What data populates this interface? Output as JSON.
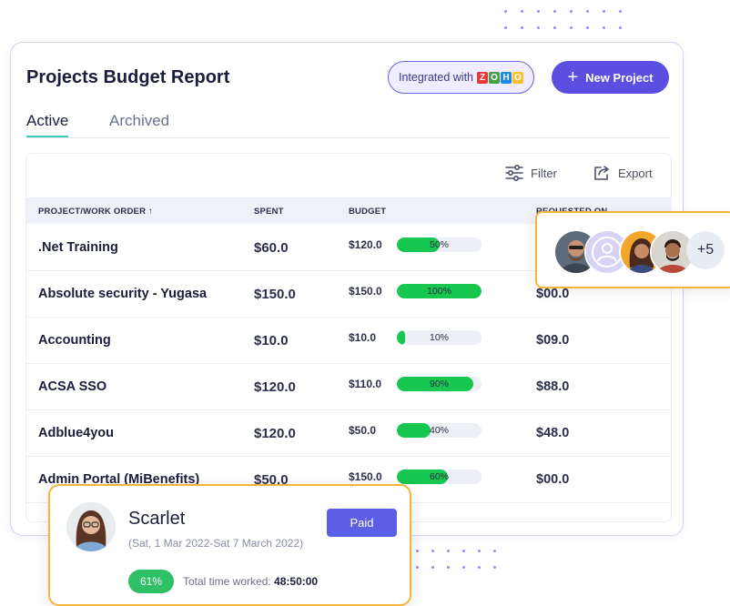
{
  "header": {
    "title": "Projects Budget Report",
    "integration_label": "Integrated with",
    "integration_logo_letters": [
      "Z",
      "O",
      "H",
      "O"
    ],
    "new_project_label": "New Project"
  },
  "tabs": [
    {
      "label": "Active",
      "active": true
    },
    {
      "label": "Archived",
      "active": false
    }
  ],
  "toolbar": {
    "filter_label": "Filter",
    "export_label": "Export"
  },
  "table": {
    "columns": {
      "project": "PROJECT/WORK ORDER ↑",
      "spent": "SPENT",
      "budget": "BUDGET",
      "requested": "REQUESTED ON"
    },
    "rows": [
      {
        "name": ".Net Training",
        "spent": "$60.0",
        "budget": "$120.0",
        "percent": 50,
        "percent_label": "50%",
        "requested": ""
      },
      {
        "name": "Absolute security - Yugasa",
        "spent": "$150.0",
        "budget": "$150.0",
        "percent": 100,
        "percent_label": "100%",
        "requested": "$00.0"
      },
      {
        "name": "Accounting",
        "spent": "$10.0",
        "budget": "$10.0",
        "percent": 10,
        "percent_label": "10%",
        "requested": "$09.0"
      },
      {
        "name": "ACSA SSO",
        "spent": "$120.0",
        "budget": "$110.0",
        "percent": 90,
        "percent_label": "90%",
        "requested": "$88.0"
      },
      {
        "name": "Adblue4you",
        "spent": "$120.0",
        "budget": "$50.0",
        "percent": 40,
        "percent_label": "40%",
        "requested": "$48.0"
      },
      {
        "name": "Admin Portal (MiBenefits)",
        "spent": "$50.0",
        "budget": "$150.0",
        "percent": 60,
        "percent_label": "60%",
        "requested": "$00.0"
      }
    ]
  },
  "team_card": {
    "extra_count": "+5"
  },
  "timesheet_card": {
    "name": "Scarlet",
    "dates": "(Sat, 1 Mar 2022-Sat 7 March 2022)",
    "status_label": "Paid",
    "percent_label": "61%",
    "total_label": "Total time worked:",
    "total_value": "48:50:00"
  },
  "colors": {
    "accent": "#5a4fe0",
    "progress": "#17c74f",
    "highlight_border": "#f3b63a",
    "tab_underline": "#3bc6c0"
  }
}
